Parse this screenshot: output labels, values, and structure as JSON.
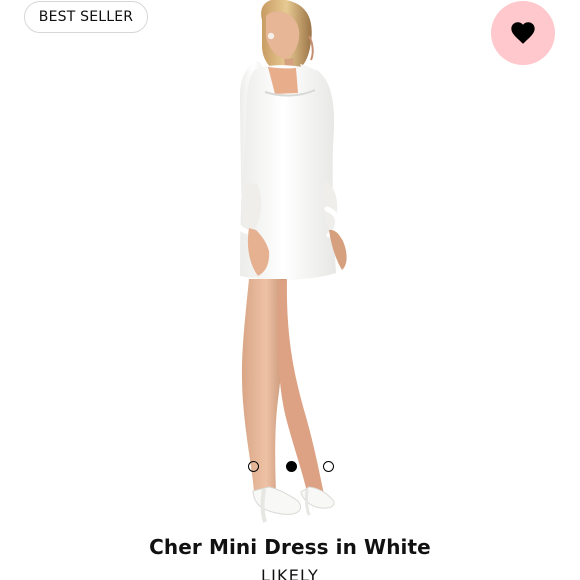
{
  "badge": {
    "label": "BEST SELLER"
  },
  "favorite": {
    "icon": "heart-icon",
    "background_color": "#ffc8cc",
    "icon_color": "#000000"
  },
  "product": {
    "image_alt": "Model wearing white mini dress with feather cuffs",
    "title": "Cher Mini Dress in White",
    "brand": "LIKELY"
  },
  "carousel": {
    "dots": [
      {
        "state": "inactive"
      },
      {
        "state": "active"
      },
      {
        "state": "inactive"
      }
    ],
    "active_index": 1
  }
}
